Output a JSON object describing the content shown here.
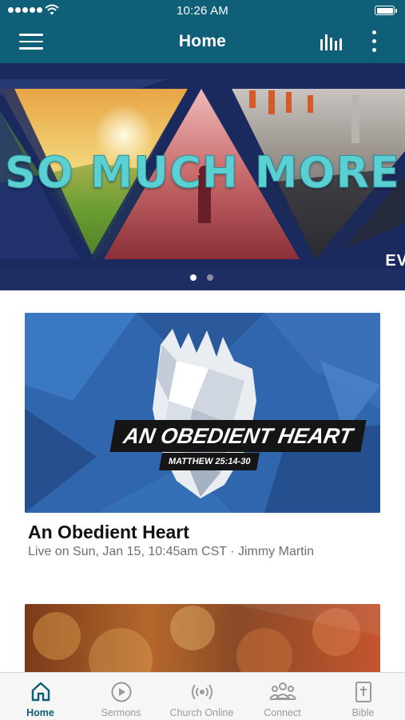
{
  "status_bar": {
    "time": "10:26 AM"
  },
  "app_bar": {
    "title": "Home",
    "menu_icon": "hamburger-menu-icon",
    "audio_icon": "audio-bars-icon",
    "more_icon": "more-vertical-icon"
  },
  "hero": {
    "headline": "SO MUCH MORE",
    "corner_text": "EV",
    "slides": 2,
    "active_slide": 1
  },
  "sermon": {
    "image_title": "AN OBEDIENT HEART",
    "image_reference": "MATTHEW 25:14-30",
    "title": "An Obedient Heart",
    "subtitle": "Live on Sun, Jan 15, 10:45am CST · Jimmy Martin"
  },
  "tabs": [
    {
      "label": "Home",
      "icon": "home-icon",
      "active": true
    },
    {
      "label": "Sermons",
      "icon": "play-circle-icon",
      "active": false
    },
    {
      "label": "Church Online",
      "icon": "broadcast-icon",
      "active": false
    },
    {
      "label": "Connect",
      "icon": "people-icon",
      "active": false
    },
    {
      "label": "Bible",
      "icon": "bible-icon",
      "active": false
    }
  ],
  "colors": {
    "brand": "#0f5f78",
    "hero_background": "#1b2a5e",
    "headline": "#5ad0d3",
    "tab_inactive": "#9a9a9a"
  }
}
